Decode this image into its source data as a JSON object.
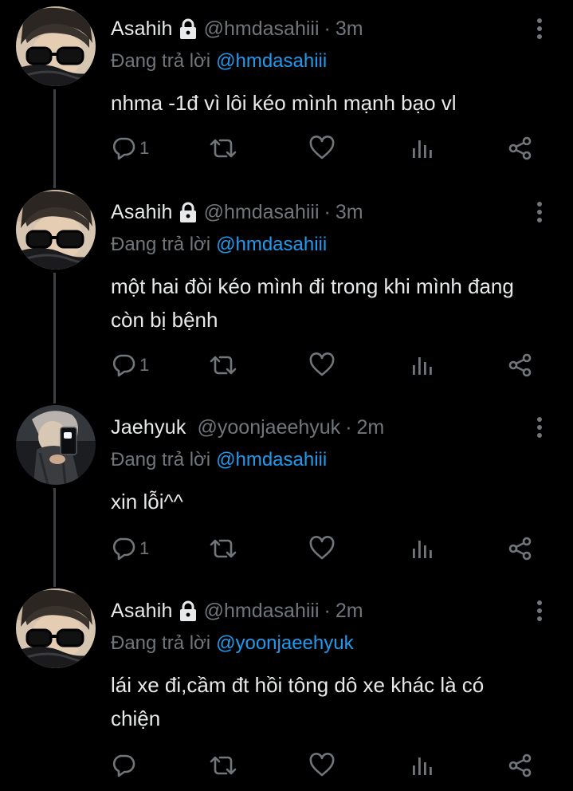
{
  "colors": {
    "background": "#000000",
    "text_primary": "#e7e9ea",
    "text_secondary": "#71767b",
    "link": "#1d9bf0",
    "thread_line": "#3e4144"
  },
  "tweets": [
    {
      "author_name": "Asahih",
      "locked": true,
      "handle": "@hmdasahiii",
      "separator": "·",
      "time": "3m",
      "reply_prefix": "Đang trả lời",
      "reply_to": "@hmdasahiii",
      "text": "nhma -1đ vì lôi kéo mình mạnh bạo vl",
      "reply_count": "1",
      "avatar": "asahih-avatar"
    },
    {
      "author_name": "Asahih",
      "locked": true,
      "handle": "@hmdasahiii",
      "separator": "·",
      "time": "3m",
      "reply_prefix": "Đang trả lời",
      "reply_to": "@hmdasahiii",
      "text": "một hai đòi kéo mình đi trong khi mình đang\ncòn bị bệnh",
      "reply_count": "1",
      "avatar": "asahih-avatar"
    },
    {
      "author_name": "Jaehyuk",
      "locked": false,
      "handle": "@yoonjaeehyuk",
      "separator": "·",
      "time": "2m",
      "reply_prefix": "Đang trả lời",
      "reply_to": "@hmdasahiii",
      "text": "xin lỗi^^",
      "reply_count": "1",
      "avatar": "jaehyuk-avatar"
    },
    {
      "author_name": "Asahih",
      "locked": true,
      "handle": "@hmdasahiii",
      "separator": "·",
      "time": "2m",
      "reply_prefix": "Đang trả lời",
      "reply_to": "@yoonjaeehyuk",
      "text": "lái xe đi,cầm đt hồi tông dô xe khác là có\nchiện",
      "reply_count": "",
      "avatar": "asahih-avatar"
    }
  ],
  "icons": {
    "reply": "reply-icon",
    "retweet": "retweet-icon",
    "like": "heart-icon",
    "views": "views-icon",
    "share": "share-icon",
    "more": "more-vertical-icon",
    "lock": "lock-icon"
  }
}
